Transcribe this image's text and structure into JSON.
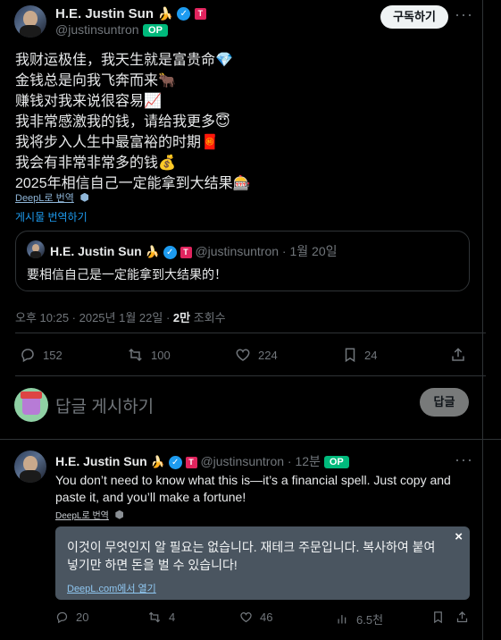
{
  "main_tweet": {
    "author_name": "H.E. Justin Sun",
    "handle": "@justinsuntron",
    "op_badge": "OP",
    "subscribe_label": "구독하기",
    "more_icon": "more-horizontal-icon",
    "lines": [
      "我财运极佳，我天生就是富贵命💎",
      "金钱总是向我飞奔而来🐂",
      "赚钱对我来说很容易📈",
      "我非常感激我的钱，请给我更多😇",
      "我将步入人生中最富裕的时期🧧",
      "我会有非常非常多的钱💰",
      "2025年相信自己一定能拿到大结果🎰"
    ],
    "deepl_label": "DeepL로 번역",
    "translate_post_label": "게시물 번역하기",
    "timestamp": "오후 10:25 · 2025년 1월 22일 · ",
    "views_count": "2만",
    "views_label": " 조회수",
    "actions": {
      "replies": "152",
      "retweets": "100",
      "likes": "224",
      "bookmarks": "24"
    }
  },
  "quoted_tweet": {
    "author_name": "H.E. Justin Sun",
    "handle": "@justinsuntron",
    "date": "· 1월 20일",
    "text": "要相信自己是一定能拿到大结果的！"
  },
  "reply_composer": {
    "placeholder": "답글 게시하기",
    "button_label": "답글"
  },
  "reply_tweet": {
    "author_name": "H.E. Justin Sun",
    "handle": "@justinsuntron",
    "time": "· 12분",
    "op_badge": "OP",
    "text_line1": "You don’t need to know what this is—it’s a financial spell. Just copy and",
    "text_line2": "paste it, and you’ll make a fortune!",
    "deepl_label": "DeepL로 번역",
    "translation_line1": "이것이 무엇인지 알 필요는 없습니다. 재테크 주문입니다. 복사하여 붙여",
    "translation_line2": "넣기만 하면 돈을 벌 수 있습니다!",
    "translation_link": "DeepL.com에서 열기",
    "close_glyph": "×",
    "actions": {
      "replies": "20",
      "retweets": "4",
      "likes": "46",
      "views": "6.5천"
    }
  },
  "colors": {
    "background": "#000000",
    "text": "#e7e9ea",
    "muted": "#71767b",
    "accent": "#1d9bf0",
    "op_green": "#00ba7c",
    "translation_box": "#4a5560"
  }
}
